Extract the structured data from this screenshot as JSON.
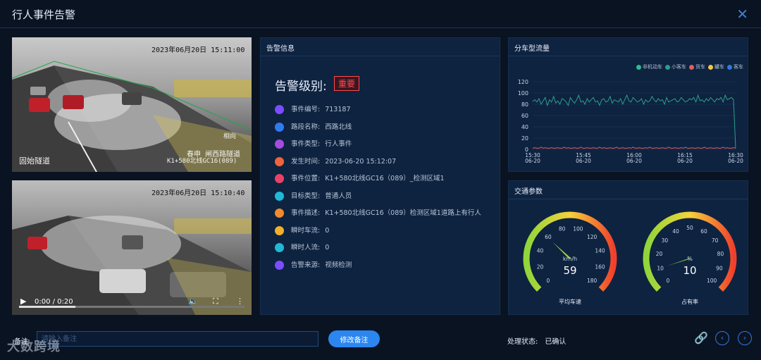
{
  "window": {
    "title": "行人事件告警",
    "close_glyph": "✕"
  },
  "video1": {
    "timestamp": "2023年06月20日 15:11:00",
    "label_left": "固始隧道",
    "label_right_top": "春申 闸西路隧道",
    "label_right_bottom": "K1+580北线GC16(089)",
    "corner_top": "相向"
  },
  "video2": {
    "timestamp": "2023年06月20日 15:10:40",
    "time_display": "0:00 / 0:20",
    "progress": 0.25
  },
  "alarm": {
    "panel_title": "告警信息",
    "level_label": "告警级别:",
    "level_value": "重要",
    "items": [
      {
        "label": "事件编号:",
        "value": "713187",
        "color": "#7b4dff",
        "icon": "list-icon"
      },
      {
        "label": "路段名称:",
        "value": "西路北线",
        "color": "#2f7cf0",
        "icon": "road-icon"
      },
      {
        "label": "事件类型:",
        "value": "行人事件",
        "color": "#a54be0",
        "icon": "grid-icon"
      },
      {
        "label": "发生时间:",
        "value": "2023-06-20 15:12:07",
        "color": "#f0643c",
        "icon": "clock-icon"
      },
      {
        "label": "事件位置:",
        "value": "K1+580北线GC16（089）_检测区域1",
        "color": "#e84366",
        "icon": "location-icon"
      },
      {
        "label": "目标类型:",
        "value": "普通人员",
        "color": "#21b8d8",
        "icon": "person-icon"
      },
      {
        "label": "事件描述:",
        "value": "K1+580北线GC16（089）检测区域1道路上有行人",
        "color": "#f08a2c",
        "icon": "edit-icon"
      },
      {
        "label": "瞬时车流:",
        "value": "0",
        "color": "#f0b02c",
        "icon": "car-icon"
      },
      {
        "label": "瞬时人流:",
        "value": "0",
        "color": "#21b8d8",
        "icon": "person-icon"
      },
      {
        "label": "告警来源:",
        "value": "视频检测",
        "color": "#7b4dff",
        "icon": "list-icon"
      }
    ]
  },
  "flow": {
    "panel_title": "分车型流量"
  },
  "traffic": {
    "panel_title": "交通参数"
  },
  "chart_data": [
    {
      "type": "line",
      "legend": [
        "非机动车",
        "小客车",
        "货车",
        "罐车",
        "客车"
      ],
      "legend_colors": [
        "#2ebd8c",
        "#2e9e8a",
        "#e25e5e",
        "#f0c93c",
        "#2f78e0"
      ],
      "ylim": [
        0,
        120
      ],
      "yticks": [
        "0",
        "20",
        "40",
        "60",
        "80",
        "100",
        "120"
      ],
      "xticks": [
        "15:30\n06-20",
        "15:45\n06-20",
        "16:00\n06-20",
        "16:15\n06-20",
        "16:30\n06-20"
      ],
      "series": [
        {
          "name": "小客车",
          "values": [
            85,
            88,
            84,
            90,
            80,
            86,
            92,
            78,
            88,
            84,
            94,
            82,
            86,
            80,
            90,
            88,
            84,
            78,
            92,
            86,
            82,
            88,
            96,
            84,
            86,
            80,
            90,
            84,
            88,
            92,
            84,
            86,
            78,
            88,
            90,
            84,
            86,
            94,
            82,
            88,
            86,
            84,
            90,
            80,
            88,
            96,
            86,
            84,
            92,
            88,
            84,
            86,
            90,
            80,
            88,
            84,
            86,
            94,
            88,
            84,
            90,
            86,
            88,
            80,
            92,
            84,
            86,
            88,
            90,
            84,
            86,
            92,
            88,
            84,
            86,
            90,
            88,
            92,
            84,
            96,
            86,
            88,
            84,
            90,
            86,
            92,
            88,
            84,
            90,
            88,
            92,
            84,
            96,
            88,
            90,
            92,
            88,
            2
          ]
        },
        {
          "name": "货车",
          "values": [
            2,
            3,
            2,
            2,
            4,
            2,
            3,
            2,
            2,
            3,
            2,
            2,
            3,
            2,
            2,
            4,
            2,
            3,
            2,
            2,
            3,
            2,
            2,
            4,
            2,
            2,
            3,
            2,
            2,
            3,
            2,
            2,
            4,
            2,
            3,
            2,
            2,
            3,
            2,
            2,
            4,
            2,
            2,
            3,
            2,
            2,
            3,
            2,
            4,
            2,
            2,
            3,
            2,
            2,
            3,
            2,
            4,
            2,
            2,
            3,
            2,
            2,
            3,
            2,
            2,
            4,
            2,
            2,
            3,
            2,
            2,
            3,
            2,
            4,
            2,
            2,
            3,
            2,
            2,
            3,
            2,
            2,
            4,
            2,
            2,
            3,
            2,
            2,
            3,
            2,
            2,
            4,
            2,
            3,
            2,
            2,
            3,
            2
          ]
        }
      ]
    },
    {
      "type": "gauge",
      "title": "平均车速",
      "unit": "km/h",
      "value": 59,
      "min": 0,
      "max": 180,
      "ticks": [
        "0",
        "20",
        "40",
        "60",
        "80",
        "100",
        "120",
        "140",
        "160",
        "180"
      ]
    },
    {
      "type": "gauge",
      "title": "占有率",
      "unit": "%",
      "value": 10,
      "min": 0,
      "max": 100,
      "ticks": [
        "0",
        "10",
        "20",
        "30",
        "40",
        "50",
        "60",
        "70",
        "80",
        "90",
        "100"
      ]
    }
  ],
  "footer": {
    "remark_label": "备注",
    "remark_placeholder": "请输入备注",
    "save_label": "修改备注",
    "status_label": "处理状态:",
    "status_value": "已确认",
    "watermark": "大数跨境"
  }
}
